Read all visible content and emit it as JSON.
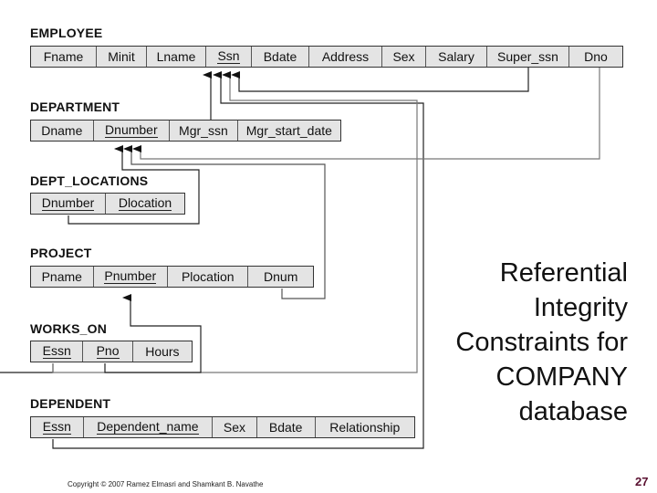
{
  "relations": {
    "employee": {
      "name": "EMPLOYEE",
      "attributes": [
        {
          "label": "Fname",
          "pk": false
        },
        {
          "label": "Minit",
          "pk": false
        },
        {
          "label": "Lname",
          "pk": false
        },
        {
          "label": "Ssn",
          "pk": true
        },
        {
          "label": "Bdate",
          "pk": false
        },
        {
          "label": "Address",
          "pk": false
        },
        {
          "label": "Sex",
          "pk": false
        },
        {
          "label": "Salary",
          "pk": false
        },
        {
          "label": "Super_ssn",
          "pk": false
        },
        {
          "label": "Dno",
          "pk": false
        }
      ]
    },
    "department": {
      "name": "DEPARTMENT",
      "attributes": [
        {
          "label": "Dname",
          "pk": false
        },
        {
          "label": "Dnumber",
          "pk": true
        },
        {
          "label": "Mgr_ssn",
          "pk": false
        },
        {
          "label": "Mgr_start_date",
          "pk": false
        }
      ]
    },
    "dept_locations": {
      "name": "DEPT_LOCATIONS",
      "attributes": [
        {
          "label": "Dnumber",
          "pk": true
        },
        {
          "label": "Dlocation",
          "pk": true
        }
      ]
    },
    "project": {
      "name": "PROJECT",
      "attributes": [
        {
          "label": "Pname",
          "pk": false
        },
        {
          "label": "Pnumber",
          "pk": true
        },
        {
          "label": "Plocation",
          "pk": false
        },
        {
          "label": "Dnum",
          "pk": false
        }
      ]
    },
    "works_on": {
      "name": "WORKS_ON",
      "attributes": [
        {
          "label": "Essn",
          "pk": true
        },
        {
          "label": "Pno",
          "pk": true
        },
        {
          "label": "Hours",
          "pk": false
        }
      ]
    },
    "dependent": {
      "name": "DEPENDENT",
      "attributes": [
        {
          "label": "Essn",
          "pk": true
        },
        {
          "label": "Dependent_name",
          "pk": true
        },
        {
          "label": "Sex",
          "pk": false
        },
        {
          "label": "Bdate",
          "pk": false
        },
        {
          "label": "Relationship",
          "pk": false
        }
      ]
    }
  },
  "references": [
    {
      "from": "EMPLOYEE.Super_ssn",
      "to": "EMPLOYEE.Ssn"
    },
    {
      "from": "EMPLOYEE.Dno",
      "to": "DEPARTMENT.Dnumber"
    },
    {
      "from": "DEPARTMENT.Mgr_ssn",
      "to": "EMPLOYEE.Ssn"
    },
    {
      "from": "DEPT_LOCATIONS.Dnumber",
      "to": "DEPARTMENT.Dnumber"
    },
    {
      "from": "PROJECT.Dnum",
      "to": "DEPARTMENT.Dnumber"
    },
    {
      "from": "WORKS_ON.Essn",
      "to": "EMPLOYEE.Ssn"
    },
    {
      "from": "WORKS_ON.Pno",
      "to": "PROJECT.Pnumber"
    },
    {
      "from": "DEPENDENT.Essn",
      "to": "EMPLOYEE.Ssn"
    }
  ],
  "slide_title": "Referential Integrity Constraints for COMPANY database",
  "copyright": "Copyright © 2007 Ramez Elmasri and Shamkant B. Navathe",
  "page_number": "27",
  "colors": {
    "cell_fill": "#e4e4e4",
    "page_number": "#5a1030"
  }
}
